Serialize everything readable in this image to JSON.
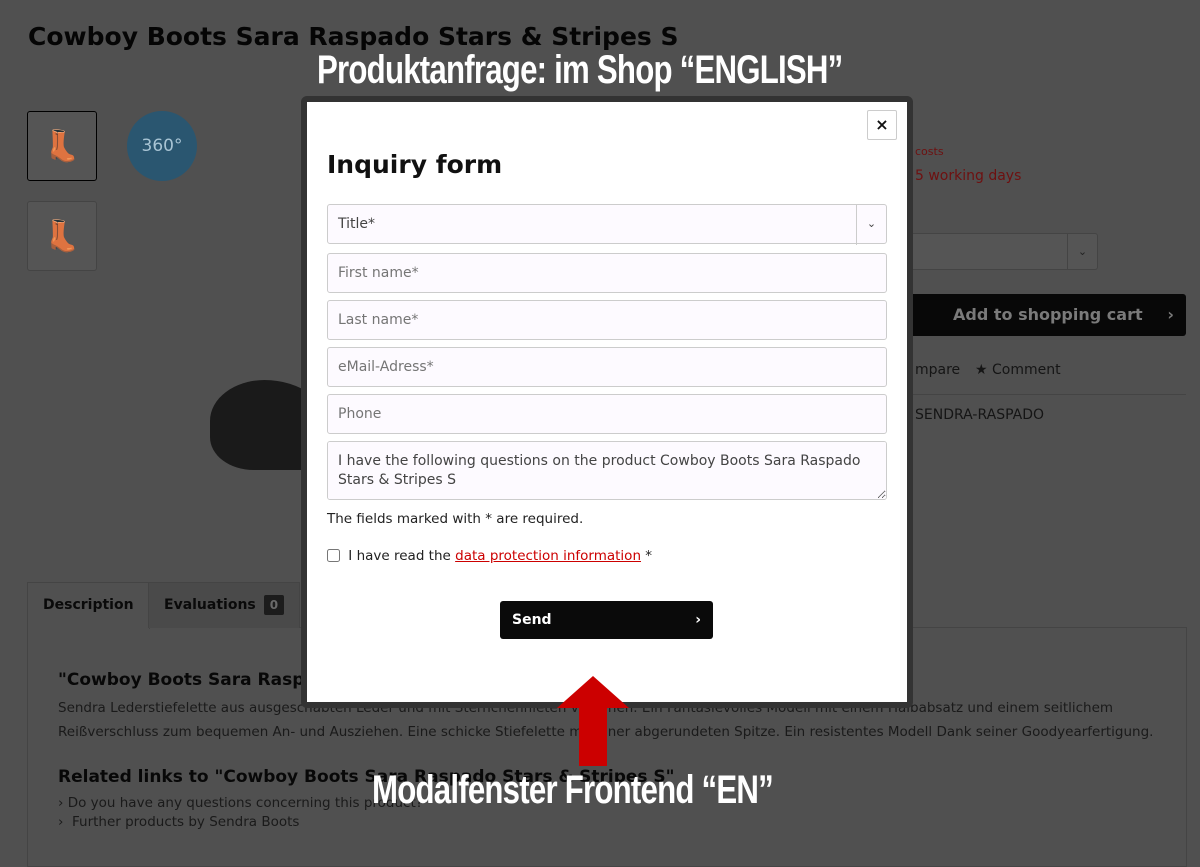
{
  "product": {
    "title": "Cowboy Boots Sara Raspado Stars & Stripes S",
    "badge_360": "360°",
    "shipping": "costs",
    "delivery": "5 working days",
    "cart": "Add to shopping cart",
    "compare": "mpare",
    "comment": "Comment",
    "sku": "SENDRA-RASPADO"
  },
  "tabs": [
    {
      "label": "Description"
    },
    {
      "label": "Evaluations",
      "count": "0"
    }
  ],
  "description": {
    "heading": "\"Cowboy Boots Sara Raspado Stars & Stripes S\"",
    "line1": "Sendra Lederstiefelette aus ausgeschabten Leder und mit Sternchennieten versehen. Ein Fantasievolles Modell mit einem Halbabsatz und einem seitlichem",
    "line2": "Reißverschluss zum bequemen An- und Ausziehen. Eine schicke Stiefelette mit einer abgerundeten Spitze. Ein resistentes Modell Dank seiner Goodyearfertigung.",
    "related": "Related links to \"Cowboy Boots Sara Raspado Stars & Stripes S\"",
    "link1": "Do you have any questions concerning this product?",
    "link2": "Further products by Sendra Boots"
  },
  "modal": {
    "title": "Inquiry form",
    "close": "×",
    "title_select": "Title*",
    "first_name": "First name*",
    "last_name": "Last name*",
    "email": "eMail-Adress*",
    "phone": "Phone",
    "message": "I have the following questions on the product Cowboy Boots Sara Raspado Stars & Stripes S",
    "required_note": "The fields marked with * are required.",
    "privacy_pre": "I have read the ",
    "privacy_link": "data protection information",
    "privacy_post": " *",
    "send": "Send"
  },
  "annotations": {
    "top": "Produktanfrage: im Shop “ENGLISH”",
    "bottom": "Modalfenster Frontend “EN”"
  },
  "colors": {
    "accent": "#cc0000",
    "arrow": "#cc0000"
  }
}
